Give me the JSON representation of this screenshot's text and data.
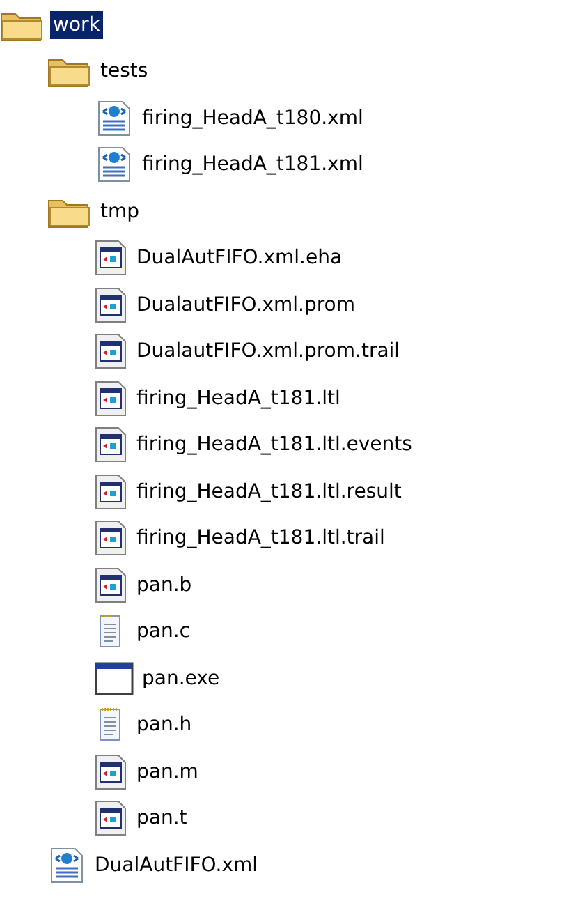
{
  "tree": [
    {
      "kind": "folder",
      "label": "work",
      "selected": true,
      "children": [
        {
          "kind": "folder",
          "label": "tests",
          "selected": false,
          "children": [
            {
              "kind": "xml",
              "label": "firing_HeadA_t180.xml",
              "selected": false
            },
            {
              "kind": "xml",
              "label": "firing_HeadA_t181.xml",
              "selected": false
            }
          ]
        },
        {
          "kind": "folder",
          "label": "tmp",
          "selected": false,
          "children": [
            {
              "kind": "app",
              "label": "DualAutFIFO.xml.eha",
              "selected": false
            },
            {
              "kind": "app",
              "label": "DualautFIFO.xml.prom",
              "selected": false
            },
            {
              "kind": "app",
              "label": "DualautFIFO.xml.prom.trail",
              "selected": false
            },
            {
              "kind": "app",
              "label": "firing_HeadA_t181.ltl",
              "selected": false
            },
            {
              "kind": "app",
              "label": "firing_HeadA_t181.ltl.events",
              "selected": false
            },
            {
              "kind": "app",
              "label": "firing_HeadA_t181.ltl.result",
              "selected": false
            },
            {
              "kind": "app",
              "label": "firing_HeadA_t181.ltl.trail",
              "selected": false
            },
            {
              "kind": "app",
              "label": "pan.b",
              "selected": false
            },
            {
              "kind": "text",
              "label": "pan.c",
              "selected": false
            },
            {
              "kind": "exe",
              "label": "pan.exe",
              "selected": false
            },
            {
              "kind": "text",
              "label": "pan.h",
              "selected": false
            },
            {
              "kind": "app",
              "label": "pan.m",
              "selected": false
            },
            {
              "kind": "app",
              "label": "pan.t",
              "selected": false
            }
          ]
        },
        {
          "kind": "xml",
          "label": "DualAutFIFO.xml",
          "selected": false
        }
      ]
    }
  ]
}
